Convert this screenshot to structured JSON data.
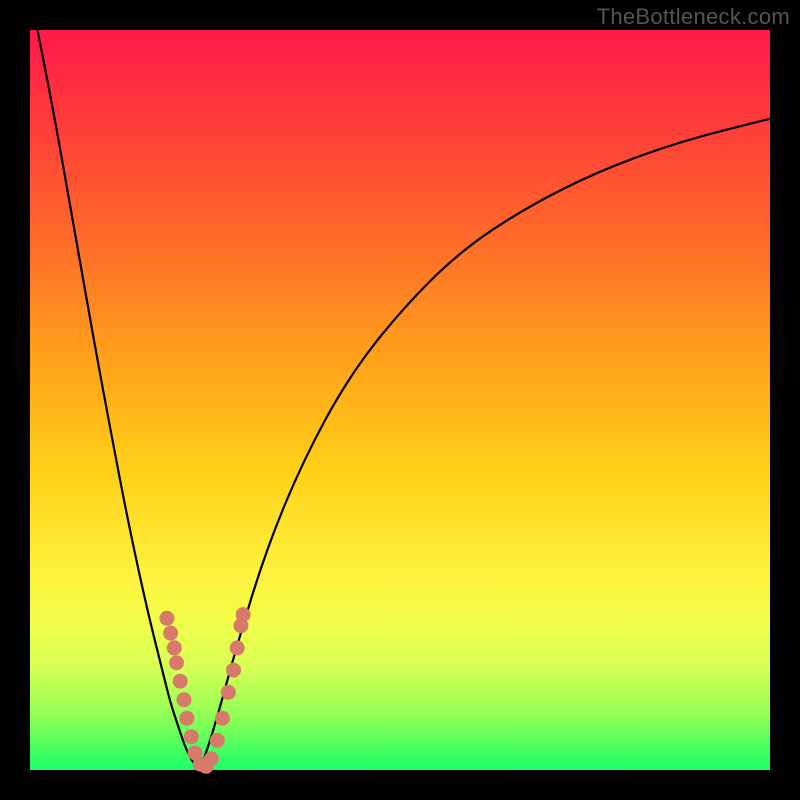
{
  "watermark": "TheBottleneck.com",
  "chart_data": {
    "type": "line",
    "title": "",
    "xlabel": "",
    "ylabel": "",
    "xlim": [
      0,
      100
    ],
    "ylim": [
      0,
      100
    ],
    "grid": false,
    "legend": false,
    "series": [
      {
        "name": "left-branch",
        "x": [
          0,
          3,
          6,
          9,
          12,
          14,
          16,
          18,
          19,
          20,
          21,
          22,
          23
        ],
        "y": [
          105,
          90,
          73,
          56,
          40,
          30,
          21,
          13,
          9,
          6,
          3,
          1,
          0
        ]
      },
      {
        "name": "right-branch",
        "x": [
          23,
          25,
          28,
          32,
          37,
          43,
          50,
          58,
          67,
          77,
          88,
          100
        ],
        "y": [
          0,
          6,
          17,
          30,
          42,
          53,
          62,
          70,
          76,
          81,
          85,
          88
        ]
      }
    ],
    "markers": {
      "name": "cluster-dots",
      "color": "#d87a6a",
      "points": [
        {
          "x": 18.5,
          "y": 20.5
        },
        {
          "x": 19.0,
          "y": 18.5
        },
        {
          "x": 19.5,
          "y": 16.5
        },
        {
          "x": 19.8,
          "y": 14.5
        },
        {
          "x": 20.3,
          "y": 12.0
        },
        {
          "x": 20.8,
          "y": 9.5
        },
        {
          "x": 21.2,
          "y": 7.0
        },
        {
          "x": 21.8,
          "y": 4.5
        },
        {
          "x": 22.3,
          "y": 2.3
        },
        {
          "x": 23.0,
          "y": 0.8
        },
        {
          "x": 23.8,
          "y": 0.5
        },
        {
          "x": 24.5,
          "y": 1.5
        },
        {
          "x": 25.3,
          "y": 4.0
        },
        {
          "x": 26.0,
          "y": 7.0
        },
        {
          "x": 26.8,
          "y": 10.5
        },
        {
          "x": 27.5,
          "y": 13.5
        },
        {
          "x": 28.0,
          "y": 16.5
        },
        {
          "x": 28.5,
          "y": 19.5
        },
        {
          "x": 28.8,
          "y": 21.0
        }
      ]
    },
    "gradient_stops": [
      {
        "pos": 0,
        "color": "#ff1a4b"
      },
      {
        "pos": 12,
        "color": "#ff3a3a"
      },
      {
        "pos": 28,
        "color": "#ff6a2a"
      },
      {
        "pos": 45,
        "color": "#ffa31a"
      },
      {
        "pos": 60,
        "color": "#ffd21a"
      },
      {
        "pos": 72,
        "color": "#ffee3a"
      },
      {
        "pos": 80,
        "color": "#f2ff4a"
      },
      {
        "pos": 86,
        "color": "#d8ff55"
      },
      {
        "pos": 93,
        "color": "#8cff55"
      },
      {
        "pos": 100,
        "color": "#1aff6a"
      }
    ]
  }
}
